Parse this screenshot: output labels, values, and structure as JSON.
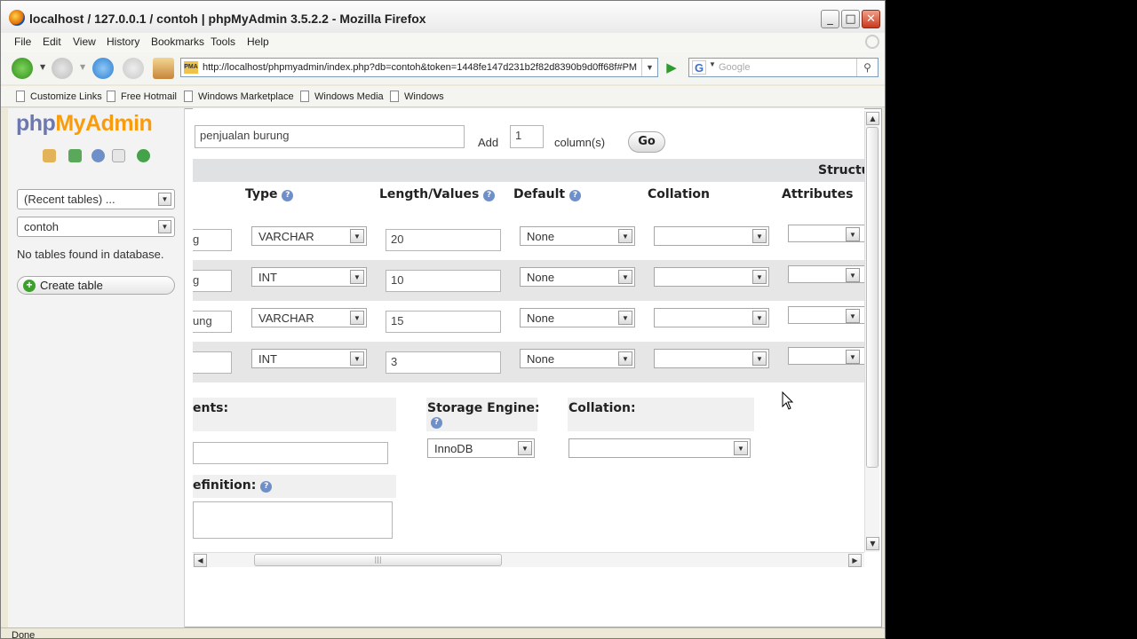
{
  "window": {
    "title": "localhost / 127.0.0.1 / contoh | phpMyAdmin 3.5.2.2 - Mozilla Firefox",
    "controls": [
      "_",
      "□",
      "✕"
    ]
  },
  "menu": [
    "File",
    "Edit",
    "View",
    "History",
    "Bookmarks",
    "Tools",
    "Help"
  ],
  "nav": {
    "url": "http://localhost/phpmyadmin/index.php?db=contoh&token=1448fe147d231b2f82d8390b9d0ff68f#PM",
    "url_icon": "PMA",
    "search_engine": "G",
    "search_placeholder": "Google"
  },
  "bookmarks": [
    "Customize Links",
    "Free Hotmail",
    "Windows Marketplace",
    "Windows Media",
    "Windows"
  ],
  "sidebar": {
    "logo_php": "php",
    "logo_myadmin": "MyAdmin",
    "recent_tables": "(Recent tables) ...",
    "database": "contoh",
    "no_tables": "No tables found in database.",
    "create_table": "Create table"
  },
  "main": {
    "table_name": "penjualan burung",
    "add_label": "Add",
    "add_count": "1",
    "columns_label": "column(s)",
    "go": "Go",
    "structure_header": "Structu",
    "headers": {
      "type": "Type",
      "length": "Length/Values",
      "default": "Default",
      "collation": "Collation",
      "attributes": "Attributes"
    },
    "rows": [
      {
        "name": "g",
        "type": "VARCHAR",
        "length": "20",
        "default": "None"
      },
      {
        "name": "g",
        "type": "INT",
        "length": "10",
        "default": "None"
      },
      {
        "name": "ung",
        "type": "VARCHAR",
        "length": "15",
        "default": "None"
      },
      {
        "name": "",
        "type": "INT",
        "length": "3",
        "default": "None"
      }
    ],
    "comments_label": "ents:",
    "storage_label": "Storage Engine:",
    "storage_value": "InnoDB",
    "collation_label": "Collation:",
    "definition_label": "efinition:"
  },
  "status": "Done"
}
